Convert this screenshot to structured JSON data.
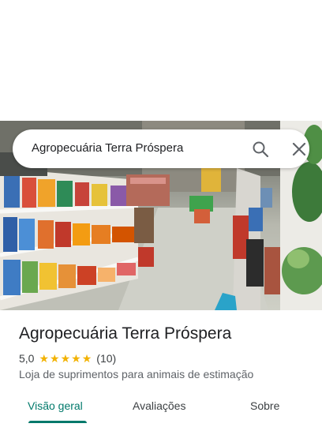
{
  "search": {
    "query": "Agropecuária Terra Próspera",
    "search_icon": "search-icon",
    "close_icon": "close-icon"
  },
  "place": {
    "title": "Agropecuária Terra Próspera",
    "rating": "5,0",
    "stars": 5,
    "review_count": "(10)",
    "category": "Loja de suprimentos para animais de estimação"
  },
  "tabs": [
    {
      "label": "Visão geral",
      "active": true
    },
    {
      "label": "Avaliações",
      "active": false
    },
    {
      "label": "Sobre",
      "active": false
    }
  ],
  "colors": {
    "accent": "#00796b",
    "star": "#f2b202",
    "text": "#202124",
    "secondary_text": "#5f6368"
  }
}
